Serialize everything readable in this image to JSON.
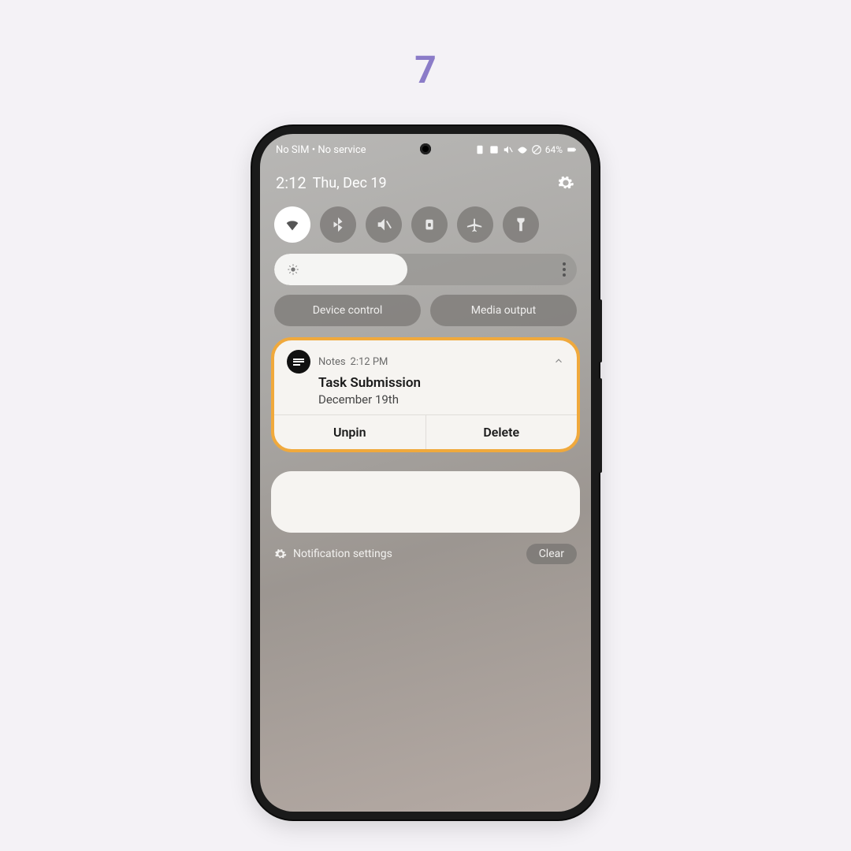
{
  "step": "7",
  "status": {
    "left": "No SIM • No service",
    "battery": "64%",
    "indicators": [
      "battery-saver",
      "nfc",
      "mute",
      "wifi",
      "no-signal"
    ]
  },
  "clock": {
    "time": "2:12",
    "date": "Thu, Dec 19"
  },
  "quick_settings": [
    {
      "name": "wifi",
      "active": true
    },
    {
      "name": "bluetooth",
      "active": false
    },
    {
      "name": "mute",
      "active": false
    },
    {
      "name": "rotation-lock",
      "active": false
    },
    {
      "name": "airplane",
      "active": false
    },
    {
      "name": "flashlight",
      "active": false
    }
  ],
  "brightness": {
    "percent": 44
  },
  "pills": {
    "device_control": "Device control",
    "media_output": "Media output"
  },
  "notification": {
    "app": "Notes",
    "time": "2:12 PM",
    "title": "Task Submission",
    "body": "December 19th",
    "action1": "Unpin",
    "action2": "Delete"
  },
  "footer": {
    "settings_label": "Notification settings",
    "clear_label": "Clear"
  }
}
